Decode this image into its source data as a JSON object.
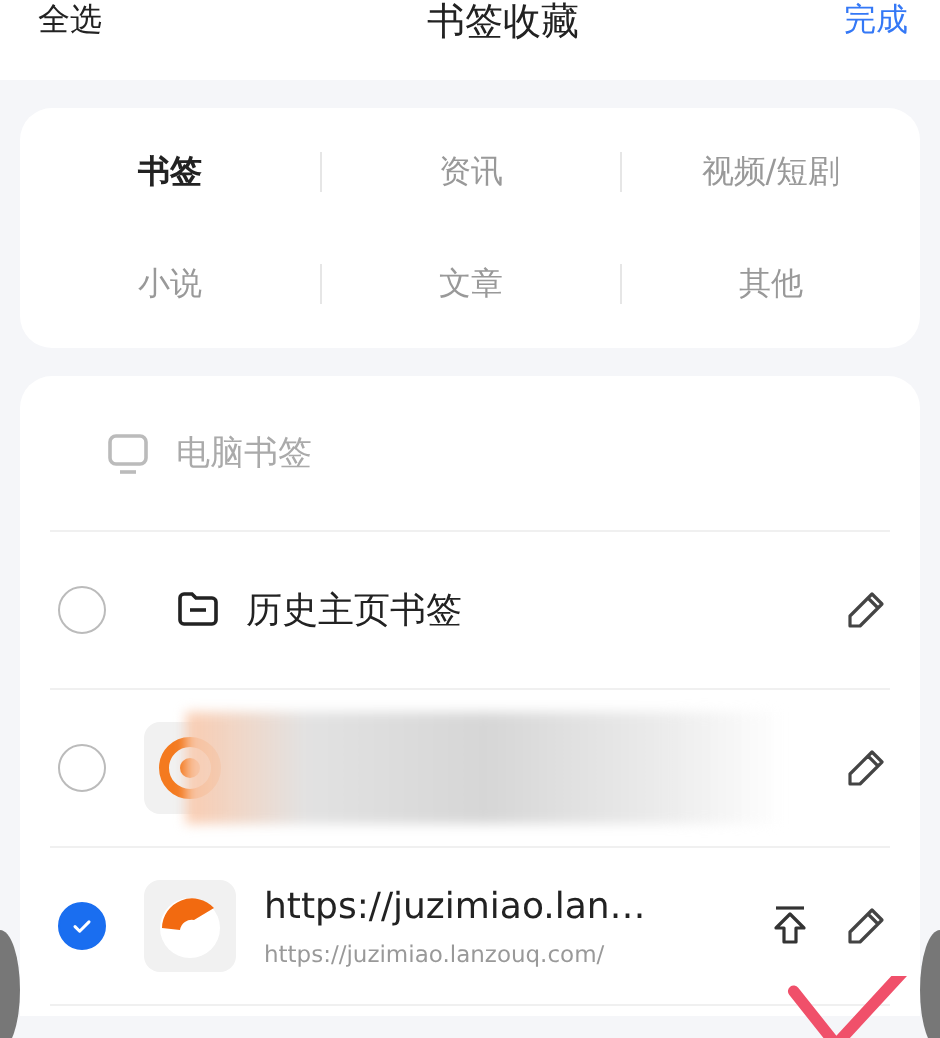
{
  "header": {
    "left": "全选",
    "title": "书签收藏",
    "right": "完成"
  },
  "categories": [
    {
      "label": "书签",
      "selected": true
    },
    {
      "label": "资讯",
      "selected": false
    },
    {
      "label": "视频/短剧",
      "selected": false
    },
    {
      "label": "小说",
      "selected": false
    },
    {
      "label": "文章",
      "selected": false
    },
    {
      "label": "其他",
      "selected": false
    }
  ],
  "section": {
    "title": "电脑书签"
  },
  "items": [
    {
      "kind": "folder",
      "title": "历史主页书签",
      "selected": false
    },
    {
      "kind": "redacted",
      "selected": false
    },
    {
      "kind": "site",
      "title": "https://juzimiao.lan…",
      "url": "https://juzimiao.lanzouq.com/",
      "selected": true,
      "pinnable": true
    }
  ],
  "annotation": {
    "kind": "check"
  }
}
